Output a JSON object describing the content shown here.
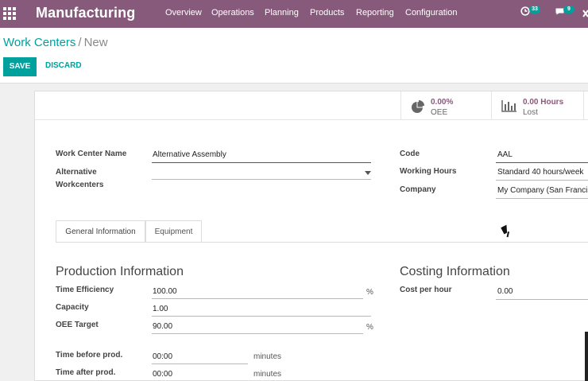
{
  "app": {
    "title": "Manufacturing"
  },
  "nav": {
    "overview": "Overview",
    "operations": "Operations",
    "planning": "Planning",
    "products": "Products",
    "reporting": "Reporting",
    "configuration": "Configuration"
  },
  "systray": {
    "activity_count": "33",
    "message_count": "9"
  },
  "breadcrumb": {
    "parent": "Work Centers",
    "separator": "/",
    "current": "New"
  },
  "buttons": {
    "save": "SAVE",
    "discard": "DISCARD"
  },
  "stats": [
    {
      "value": "0.00%",
      "label": "OEE"
    },
    {
      "value": "0.00 Hours",
      "label": "Lost"
    }
  ],
  "form": {
    "work_center_name_label": "Work Center Name",
    "work_center_name": "Alternative Assembly",
    "alternative_label_1": "Alternative",
    "alternative_label_2": "Workcenters",
    "code_label": "Code",
    "code": "AAL",
    "working_hours_label": "Working Hours",
    "working_hours": "Standard 40 hours/week",
    "company_label": "Company",
    "company": "My Company (San Francisco)"
  },
  "tabs": {
    "general": "General Information",
    "equipment": "Equipment"
  },
  "production": {
    "title": "Production Information",
    "time_efficiency_label": "Time Efficiency",
    "time_efficiency": "100.00",
    "percent_1": "%",
    "capacity_label": "Capacity",
    "capacity": "1.00",
    "oee_target_label": "OEE Target",
    "oee_target": "90.00",
    "percent_2": "%",
    "time_before_label": "Time before prod.",
    "time_before": "00:00",
    "time_before_unit": "minutes",
    "time_after_label": "Time after prod.",
    "time_after": "00:00",
    "time_after_unit": "minutes"
  },
  "costing": {
    "title": "Costing Information",
    "cost_per_hour_label": "Cost per hour",
    "cost_per_hour": "0.00"
  },
  "icons": {
    "apps": "grid-icon",
    "activity": "clock-icon",
    "messages": "chat-icon",
    "close": "close-icon",
    "oee": "pie-chart-icon",
    "lost": "bar-chart-icon",
    "dropdown": "caret-down-icon",
    "cursor": "mouse-pointer-icon"
  },
  "colors": {
    "brand": "#875a7b",
    "accent": "#00a09d"
  }
}
